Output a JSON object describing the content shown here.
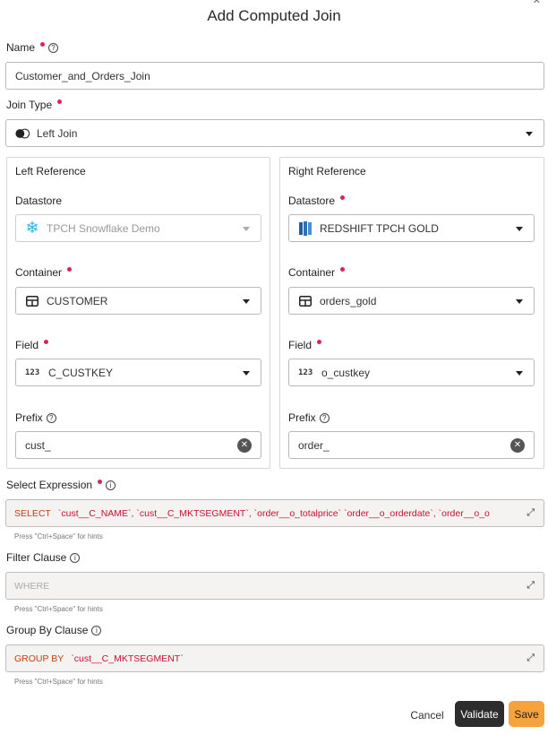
{
  "dialog": {
    "title": "Add Computed Join",
    "close_icon": "close-icon"
  },
  "name": {
    "label": "Name",
    "value": "Customer_and_Orders_Join"
  },
  "join_type": {
    "label": "Join Type",
    "value": "Left Join",
    "icon": "venn-icon"
  },
  "left": {
    "title": "Left Reference",
    "datastore_label": "Datastore",
    "datastore_value": "TPCH Snowflake Demo",
    "container_label": "Container",
    "container_value": "CUSTOMER",
    "field_label": "Field",
    "field_icon_text": "123",
    "field_value": "C_CUSTKEY",
    "prefix_label": "Prefix",
    "prefix_value": "cust_"
  },
  "right": {
    "title": "Right Reference",
    "datastore_label": "Datastore",
    "datastore_value": "REDSHIFT TPCH GOLD",
    "container_label": "Container",
    "container_value": "orders_gold",
    "field_label": "Field",
    "field_icon_text": "123",
    "field_value": "o_custkey",
    "prefix_label": "Prefix",
    "prefix_value": "order_"
  },
  "select_expression": {
    "label": "Select Expression",
    "keyword": "SELECT",
    "value": "`cust__C_NAME`, `cust__C_MKTSEGMENT`, `order__o_totalprice` `order__o_orderdate`, `order__o_o",
    "hint": "Press \"Ctrl+Space\" for hints"
  },
  "filter_clause": {
    "label": "Filter Clause",
    "placeholder": "WHERE",
    "hint": "Press \"Ctrl+Space\" for hints"
  },
  "group_by": {
    "label": "Group By Clause",
    "keyword": "GROUP BY",
    "value": "`cust__C_MKTSEGMENT`",
    "hint": "Press \"Ctrl+Space\" for hints"
  },
  "actions": {
    "cancel": "Cancel",
    "validate": "Validate",
    "save": "Save"
  },
  "colors": {
    "required": "#d6245e",
    "save": "#f7a33b",
    "validate": "#2d2d2d",
    "sql_keyword": "#c2410c",
    "sql_expr": "#c8102e"
  }
}
